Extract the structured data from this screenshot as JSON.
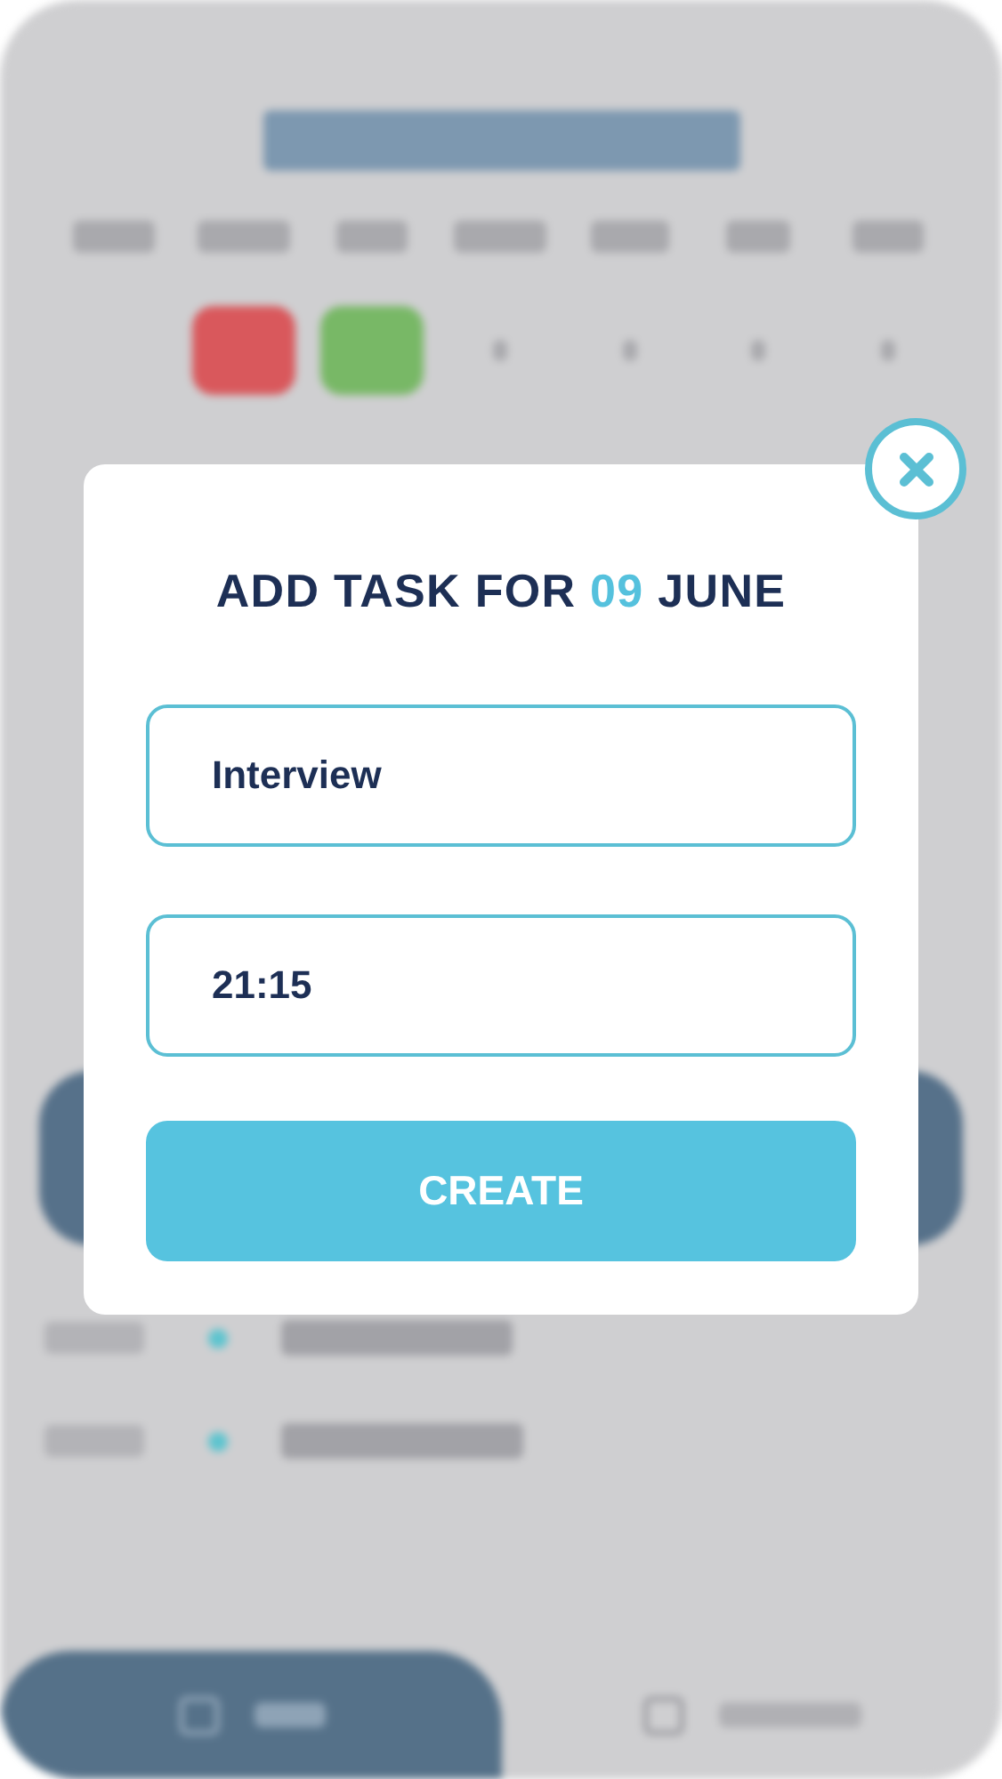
{
  "background": {
    "highlighted_days": [
      {
        "color": "#d9585c"
      },
      {
        "color": "#78b866"
      }
    ],
    "tabs": [
      {
        "selected": true
      },
      {
        "selected": false
      }
    ]
  },
  "modal": {
    "title_before": "ADD TASK FOR",
    "title_day": "09",
    "title_after": "JUNE",
    "fields": [
      {
        "value": "Interview"
      },
      {
        "value": "21:15"
      }
    ],
    "button": "CREATE"
  }
}
